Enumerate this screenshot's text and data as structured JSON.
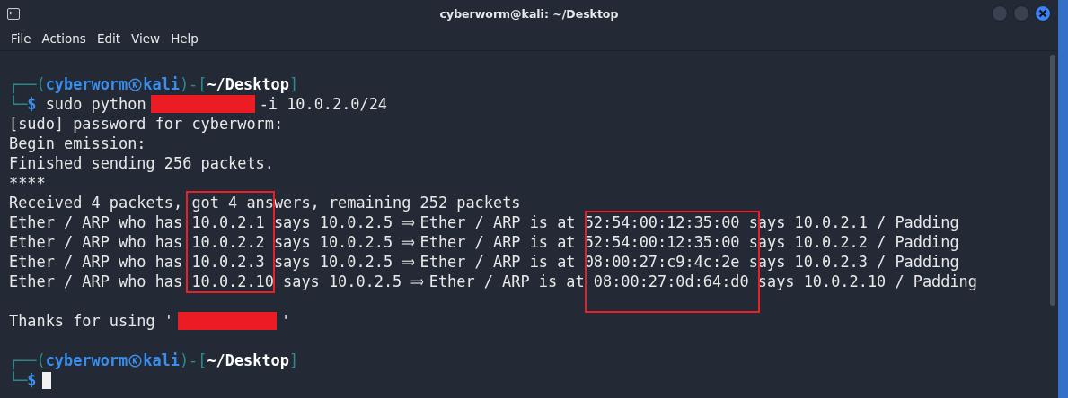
{
  "window": {
    "title": "cyberworm@kali: ~/Desktop"
  },
  "menu": [
    "File",
    "Actions",
    "Edit",
    "View",
    "Help"
  ],
  "lines": [
    {
      "kind": "blank"
    },
    {
      "kind": "prompt-head",
      "open": "┌──(",
      "user": "cyberworm",
      "host": "kali",
      "sep": ")-[",
      "dir": "~/Desktop",
      "close": "]"
    },
    {
      "kind": "prompt-cmd",
      "lead": "└─",
      "symbol": "$",
      "parts": [
        {
          "kind": "text",
          "text": "sudo python"
        },
        {
          "kind": "redacted"
        },
        {
          "kind": "text",
          "text": "-i 10.0.2.0/24"
        }
      ]
    },
    {
      "kind": "text",
      "text": "[sudo] password for cyberworm:"
    },
    {
      "kind": "text",
      "text": "Begin emission:"
    },
    {
      "kind": "text",
      "text": "Finished sending 256 packets."
    },
    {
      "kind": "text",
      "text": "****"
    },
    {
      "kind": "text",
      "text": "Received 4 packets, got 4 answers, remaining 252 packets"
    },
    {
      "kind": "text",
      "text": "Ether / ARP who has 10.0.2.1 says 10.0.2.5 ⟹ Ether / ARP is at 52:54:00:12:35:00 says 10.0.2.1 / Padding"
    },
    {
      "kind": "text",
      "text": "Ether / ARP who has 10.0.2.2 says 10.0.2.5 ⟹ Ether / ARP is at 52:54:00:12:35:00 says 10.0.2.2 / Padding"
    },
    {
      "kind": "text",
      "text": "Ether / ARP who has 10.0.2.3 says 10.0.2.5 ⟹ Ether / ARP is at 08:00:27:c9:4c:2e says 10.0.2.3 / Padding"
    },
    {
      "kind": "text",
      "text": "Ether / ARP who has 10.0.2.10 says 10.0.2.5 ⟹ Ether / ARP is at 08:00:27:0d:64:d0 says 10.0.2.10 / Padding"
    },
    {
      "kind": "blank"
    },
    {
      "kind": "mixed",
      "parts": [
        {
          "kind": "text",
          "text": "Thanks for using '"
        },
        {
          "kind": "redacted"
        },
        {
          "kind": "text",
          "text": "'"
        }
      ]
    },
    {
      "kind": "blank"
    },
    {
      "kind": "prompt-head",
      "open": "┌──(",
      "user": "cyberworm",
      "host": "kali",
      "sep": ")-[",
      "dir": "~/Desktop",
      "close": "]"
    },
    {
      "kind": "prompt-cmd",
      "lead": "└─",
      "symbol": "$",
      "cursor": true
    }
  ],
  "annotations": {
    "ip_column_box": true,
    "mac_column_box": true
  }
}
